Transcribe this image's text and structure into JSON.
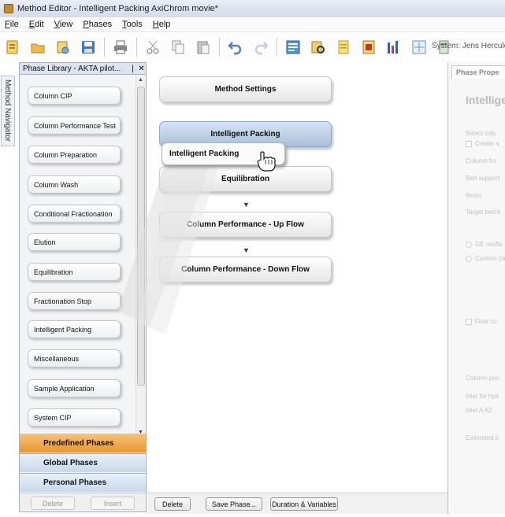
{
  "window": {
    "title": "Method Editor - Intelligent Packing AxiChrom movie*"
  },
  "menu": [
    "File",
    "Edit",
    "View",
    "Phases",
    "Tools",
    "Help"
  ],
  "toolbar": {
    "system_label": "System: Jens Hercule"
  },
  "side_tab": {
    "label": "Method Navigator"
  },
  "library": {
    "title": "Phase Library - AKTA pilot...",
    "pin_glyph": "❘",
    "close_glyph": "✕",
    "items": [
      "Column CIP",
      "Column Performance Test",
      "Column Preparation",
      "Column Wash",
      "Conditional Fractionation",
      "Elution",
      "Equilibration",
      "Fractionation Stop",
      "Intelligent Packing",
      "Miscellaneous",
      "Sample Application",
      "System CIP"
    ],
    "categories": [
      "Predefined Phases",
      "Global Phases",
      "Personal Phases"
    ],
    "buttons": {
      "delete": "Delete",
      "insert": "Insert"
    }
  },
  "method": {
    "settings_label": "Method Settings",
    "phases": [
      "Intelligent Packing",
      "Equilibration",
      "Column Performance - Up Flow",
      "Column Performance - Down Flow"
    ],
    "drag_ghost_label": "Intelligent Packing",
    "buttons": {
      "delete": "Delete",
      "save_phase": "Save Phase...",
      "duration": "Duration & Variables"
    }
  },
  "properties": {
    "tab_label": "Phase Prope",
    "title": "Intellige",
    "labels": [
      "Select colu",
      "Create a",
      "Column fro",
      "Bed support",
      "Resin",
      "Target bed h",
      "GE verifie",
      "Custom pa",
      "Flow co",
      "Column pos",
      "Inlet for hyd",
      "Inlet A    A2",
      "Estimated ti"
    ]
  },
  "colors": {
    "selected_phase": "#a8c0da",
    "predefined_tab": "#e8962c",
    "category_tab": "#c8d9ea"
  }
}
